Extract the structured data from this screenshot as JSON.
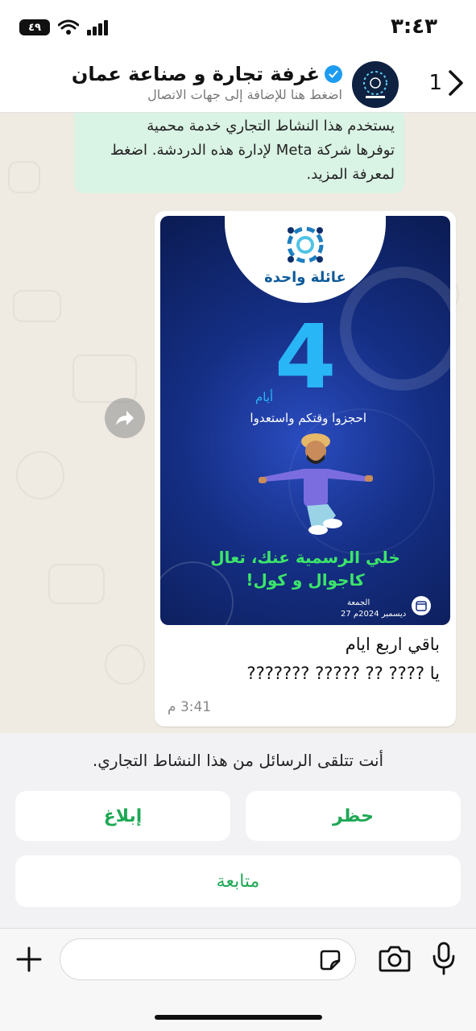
{
  "status_bar": {
    "time": "٣:٤٣",
    "battery": "٤٩"
  },
  "header": {
    "back_count": "1",
    "contact_name": "غرفة تجارة و صناعة عمان",
    "subtitle": "اضغط هنا للإضافة إلى جهات الاتصال"
  },
  "system_message": {
    "line1": "يستخدم هذا النشاط التجاري خدمة محمية",
    "line2": "توفرها شركة Meta لإدارة هذه الدردشة. اضغط",
    "line3": "لمعرفة المزيد."
  },
  "poster": {
    "brand": "عائلة واحدة",
    "big_number": "4",
    "days_label": "أيام",
    "tagline": "احجزوا وقتكم واستعدوا",
    "promo_line1": "خلي الرسمية عنك، تعال",
    "promo_line2": "كاجوال و كول!",
    "day_name": "الجمعة",
    "date": "27 ديسمبر 2024م"
  },
  "message": {
    "line1": "باقي اربع ايام",
    "line2": "يا ???? ?? ????? ???????",
    "time": "3:41 م"
  },
  "business_panel": {
    "notice": "أنت تتلقى الرسائل من هذا النشاط التجاري.",
    "block_label": "حظر",
    "report_label": "إبلاغ",
    "follow_label": "متابعة"
  },
  "icons": {
    "back": "chevron-right-icon",
    "forward": "forward-icon",
    "plus": "plus-icon",
    "sticker": "sticker-icon",
    "camera": "camera-icon",
    "mic": "microphone-icon"
  },
  "colors": {
    "accent_green": "#1fa855",
    "system_bubble": "#d9f3e4",
    "poster_blue": "#152f85",
    "verified_blue": "#1d9bf0"
  }
}
